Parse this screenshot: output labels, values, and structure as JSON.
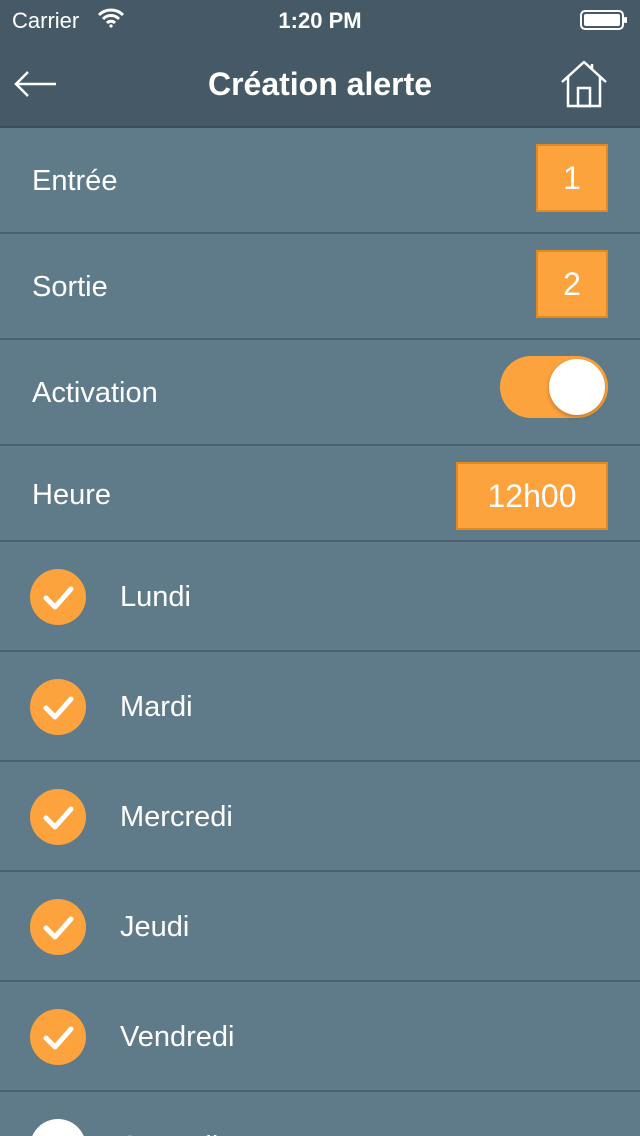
{
  "status_bar": {
    "carrier": "Carrier",
    "time": "1:20 PM"
  },
  "nav": {
    "title": "Création alerte",
    "back_icon": "arrow-left-icon",
    "home_icon": "home-icon"
  },
  "settings": {
    "entree_label": "Entrée",
    "entree_value": "1",
    "sortie_label": "Sortie",
    "sortie_value": "2",
    "activation_label": "Activation",
    "activation_on": true,
    "heure_label": "Heure",
    "heure_value": "12h00"
  },
  "days": [
    {
      "label": "Lundi",
      "checked": true
    },
    {
      "label": "Mardi",
      "checked": true
    },
    {
      "label": "Mercredi",
      "checked": true
    },
    {
      "label": "Jeudi",
      "checked": true
    },
    {
      "label": "Vendredi",
      "checked": true
    },
    {
      "label": "Samedi",
      "checked": false
    }
  ],
  "colors": {
    "accent": "#fca33d",
    "header_bg": "#455a66",
    "list_bg": "#5f7b89"
  }
}
